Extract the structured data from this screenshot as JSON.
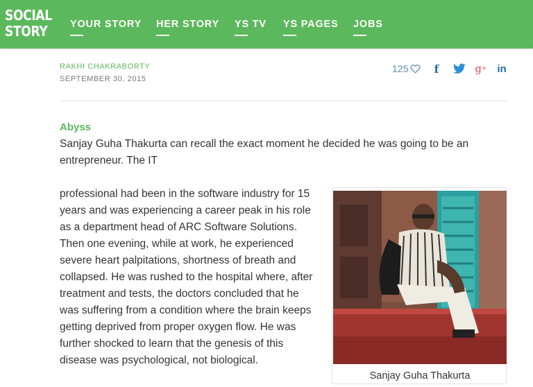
{
  "nav": {
    "logo_line1": "SOCIAL",
    "logo_line2": "STORY",
    "items": [
      {
        "label": "YOUR STORY"
      },
      {
        "label": "HER STORY"
      },
      {
        "label": "YS TV"
      },
      {
        "label": "YS PAGES"
      },
      {
        "label": "JOBS"
      }
    ]
  },
  "article": {
    "author": "RAKHI CHAKRABORTY",
    "date": "SEPTEMBER 30, 2015",
    "likes": "125",
    "section_title": "Abyss",
    "intro": "Sanjay Guha Thakurta can recall the exact moment he decided he was going to be an entrepreneur. The IT",
    "body": "professional had been in the software industry for 15 years and was experiencing a career peak in his role as a department head of ARC Software Solutions. Then one evening, while at work, he experienced severe heart palpitations, shortness of breath and collapsed. He was rushed to the hospital where, after treatment and tests, the doctors concluded that he was suffering from a condition where the brain keeps getting deprived from proper oxygen flow. He was further shocked to learn that the genesis of this disease was psychological, not biological.",
    "image_caption": "Sanjay Guha Thakurta"
  },
  "social": {
    "facebook_glyph": "f",
    "googleplus_glyph": "g",
    "googleplus_sup": "+",
    "linkedin_glyph": "in"
  },
  "icons": {
    "heart": "heart-icon",
    "facebook": "facebook-icon",
    "twitter": "twitter-icon",
    "googleplus": "google-plus-icon",
    "linkedin": "linkedin-icon"
  },
  "colors": {
    "brand_green": "#5cb85c",
    "link_blue": "#2f70a8",
    "google_red": "#d9534f"
  }
}
